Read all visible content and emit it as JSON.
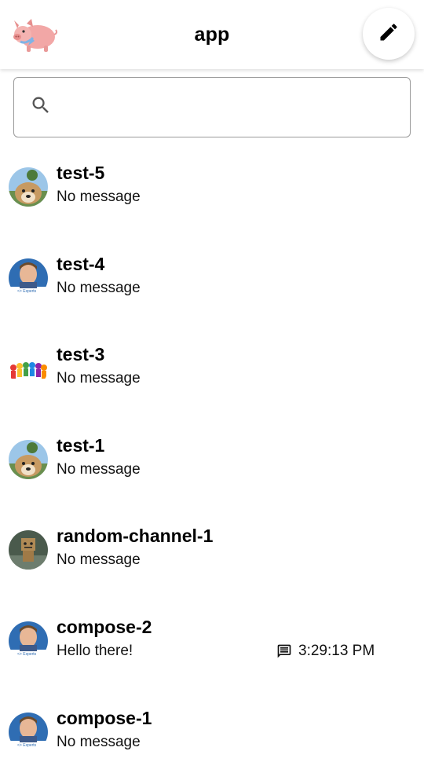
{
  "header": {
    "title": "app"
  },
  "search": {
    "placeholder": "",
    "value": ""
  },
  "channels": [
    {
      "name": "test-5",
      "preview": "No message",
      "avatar": "dog-avatar"
    },
    {
      "name": "test-4",
      "preview": "No message",
      "avatar": "person-avatar"
    },
    {
      "name": "test-3",
      "preview": "No message",
      "avatar": "group-avatar"
    },
    {
      "name": "test-1",
      "preview": "No message",
      "avatar": "dog-avatar"
    },
    {
      "name": "random-channel-1",
      "preview": "No message",
      "avatar": "robot-avatar"
    },
    {
      "name": "compose-2",
      "preview": "Hello there!",
      "avatar": "person-avatar",
      "time": "3:29:13 PM"
    },
    {
      "name": "compose-1",
      "preview": "No message",
      "avatar": "person-avatar"
    }
  ],
  "colors": {
    "accent": "#000000",
    "border": "#9a9a9a"
  }
}
